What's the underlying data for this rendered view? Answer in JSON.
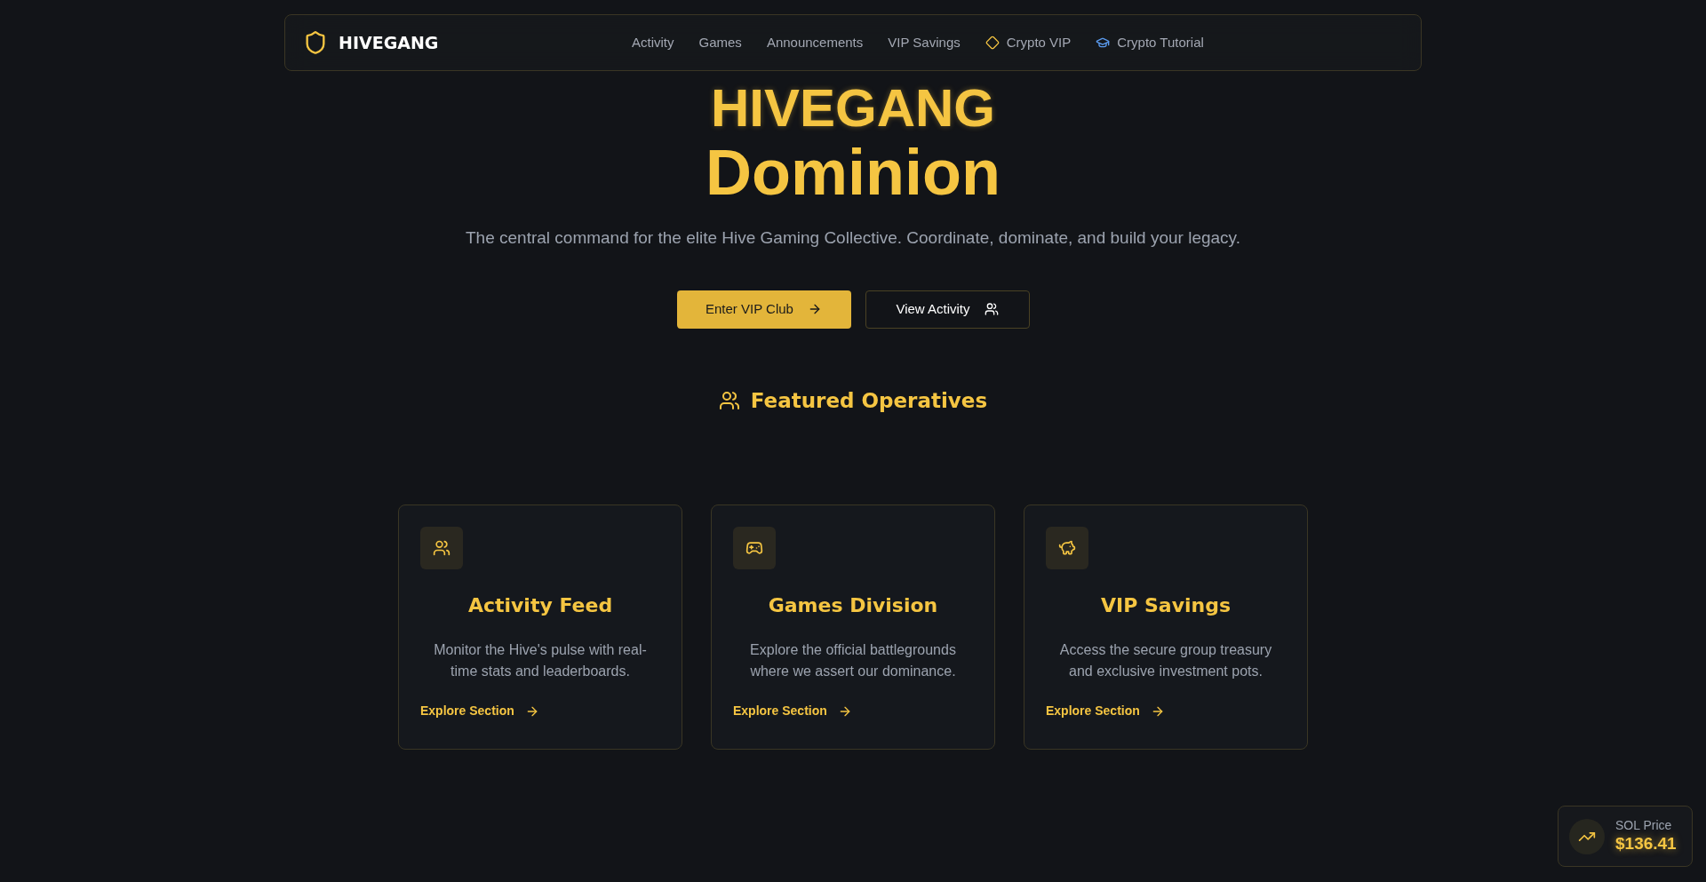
{
  "nav": {
    "logo": "HIVEGANG",
    "links": [
      {
        "label": "Activity",
        "kind": "plain"
      },
      {
        "label": "Games",
        "kind": "plain"
      },
      {
        "label": "Announcements",
        "kind": "plain"
      },
      {
        "label": "VIP Savings",
        "kind": "plain"
      },
      {
        "label": "Crypto VIP",
        "kind": "diamond"
      },
      {
        "label": "Crypto Tutorial",
        "kind": "cap"
      }
    ]
  },
  "hero": {
    "title_line1": "HIVEGANG",
    "title_line2": "Dominion",
    "subtitle": "The central command for the elite Hive Gaming Collective. Coordinate, dominate, and build your legacy.",
    "buttons": [
      {
        "label": "Enter VIP Club",
        "kind": "primary"
      },
      {
        "label": "View Activity",
        "kind": "secondary"
      }
    ]
  },
  "featured": {
    "heading": "Featured Operatives"
  },
  "cards": [
    {
      "kind": "users",
      "title": "Activity Feed",
      "description": "Monitor the Hive's pulse with real-time stats and leaderboards.",
      "link": "Explore Section"
    },
    {
      "kind": "gamepad",
      "title": "Games Division",
      "description": "Explore the official battlegrounds where we assert our dominance.",
      "link": "Explore Section"
    },
    {
      "kind": "piggy",
      "title": "VIP Savings",
      "description": "Access the secure group treasury and exclusive investment pots.",
      "link": "Explore Section"
    }
  ],
  "price_widget": {
    "label": "SOL Price",
    "value": "$136.41"
  }
}
